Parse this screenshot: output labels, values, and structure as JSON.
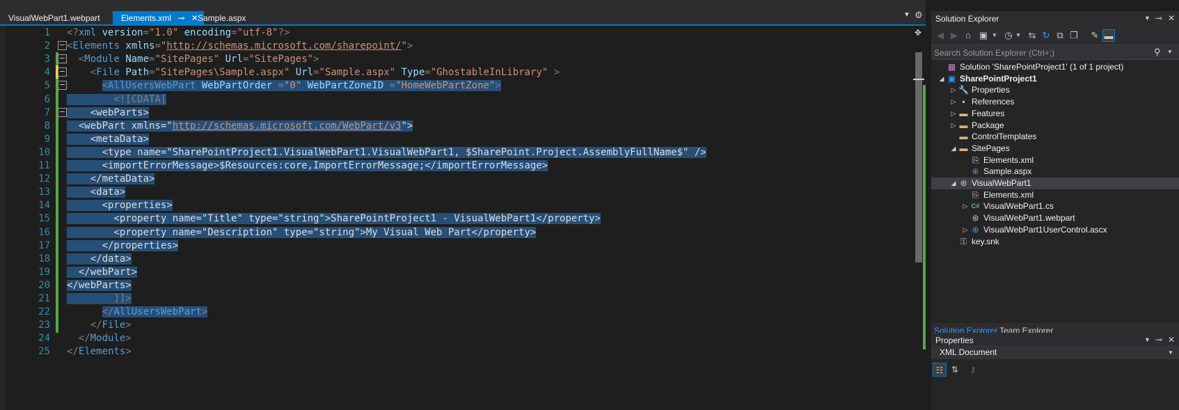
{
  "tabs": {
    "items": [
      {
        "label": "VisualWebPart1.webpart",
        "active": false
      },
      {
        "label": "Elements.xml",
        "active": true
      },
      {
        "label": "Sample.aspx",
        "active": false
      }
    ],
    "pin_icon": "pin-icon",
    "close_icon": "close-icon",
    "menu_icon": "chevron-down-icon",
    "gear_icon": "gear-icon"
  },
  "editor": {
    "line_numbers": [
      "1",
      "2",
      "3",
      "4",
      "5",
      "6",
      "7",
      "8",
      "9",
      "10",
      "11",
      "12",
      "13",
      "14",
      "15",
      "16",
      "17",
      "18",
      "19",
      "20",
      "21",
      "22",
      "23",
      "24",
      "25"
    ],
    "colors": {
      "tag": "#569cd6",
      "attr": "#9cdcfe",
      "string": "#ce9178",
      "text": "#dcdcdc",
      "punct": "#808080",
      "selection": "#264f78",
      "line_number": "#2b91af"
    },
    "lines": [
      [
        [
          "pun",
          "<?"
        ],
        [
          "tag",
          "xml "
        ],
        [
          "attr",
          "version"
        ],
        [
          "pun",
          "="
        ],
        [
          "str",
          "\"1.0\""
        ],
        [
          "pun",
          " "
        ],
        [
          "attr",
          "encoding"
        ],
        [
          "pun",
          "="
        ],
        [
          "str",
          "\"utf-8\""
        ],
        [
          "pun",
          "?>"
        ]
      ],
      [
        [
          "pun",
          "<"
        ],
        [
          "tag",
          "Elements "
        ],
        [
          "attr",
          "xmlns"
        ],
        [
          "pun",
          "="
        ],
        [
          "str",
          "\""
        ],
        [
          "url",
          "http://schemas.microsoft.com/sharepoint/"
        ],
        [
          "str",
          "\""
        ],
        [
          "pun",
          ">"
        ]
      ],
      [
        [
          "pun",
          "  <"
        ],
        [
          "tag",
          "Module "
        ],
        [
          "attr",
          "Name"
        ],
        [
          "pun",
          "="
        ],
        [
          "str",
          "\"SitePages\""
        ],
        [
          "pun",
          " "
        ],
        [
          "attr",
          "Url"
        ],
        [
          "pun",
          "="
        ],
        [
          "str",
          "\"SitePages\""
        ],
        [
          "pun",
          ">"
        ]
      ],
      [
        [
          "pun",
          "    <"
        ],
        [
          "tag",
          "File "
        ],
        [
          "attr",
          "Path"
        ],
        [
          "pun",
          "="
        ],
        [
          "str",
          "\"SitePages\\Sample.aspx\""
        ],
        [
          "pun",
          " "
        ],
        [
          "attr",
          "Url"
        ],
        [
          "pun",
          "="
        ],
        [
          "str",
          "\"Sample.aspx\""
        ],
        [
          "pun",
          " "
        ],
        [
          "attr",
          "Type"
        ],
        [
          "pun",
          "="
        ],
        [
          "str",
          "\"GhostableInLibrary\""
        ],
        [
          "pun",
          " >"
        ]
      ],
      [
        [
          "pun",
          "      "
        ],
        [
          "selpun",
          "<"
        ],
        [
          "seltag",
          "AllUsersWebPart "
        ],
        [
          "selattr",
          "WebPartOrder "
        ],
        [
          "selpun",
          "="
        ],
        [
          "selstr",
          "\"0\""
        ],
        [
          "selpun",
          " "
        ],
        [
          "selattr",
          "WebPartZoneID "
        ],
        [
          "selpun",
          "="
        ],
        [
          "selstr",
          "\"HomeWebPartZone\""
        ],
        [
          "selpun",
          ">"
        ]
      ],
      [
        [
          "selpun",
          "        <![CDATA["
        ]
      ],
      [
        [
          "seltxt",
          "    <webParts>"
        ]
      ],
      [
        [
          "seltxt",
          "  <webPart xmlns=\""
        ],
        [
          "selurl",
          "http://schemas.microsoft.com/WebPart/v3"
        ],
        [
          "seltxt",
          "\">"
        ]
      ],
      [
        [
          "seltxt",
          "    <metaData>"
        ]
      ],
      [
        [
          "seltxt",
          "      <type name=\"SharePointProject1.VisualWebPart1.VisualWebPart1, $SharePoint.Project.AssemblyFullName$\" />"
        ]
      ],
      [
        [
          "seltxt",
          "      <importErrorMessage>$Resources:core,ImportErrorMessage;</importErrorMessage>"
        ]
      ],
      [
        [
          "seltxt",
          "    </metaData>"
        ]
      ],
      [
        [
          "seltxt",
          "    <data>"
        ]
      ],
      [
        [
          "seltxt",
          "      <properties>"
        ]
      ],
      [
        [
          "seltxt",
          "        <property name=\"Title\" type=\"string\">SharePointProject1 - VisualWebPart1</property>"
        ]
      ],
      [
        [
          "seltxt",
          "        <property name=\"Description\" type=\"string\">My Visual Web Part</property>"
        ]
      ],
      [
        [
          "seltxt",
          "      </properties>"
        ]
      ],
      [
        [
          "seltxt",
          "    </data>"
        ]
      ],
      [
        [
          "seltxt",
          "  </webPart>"
        ]
      ],
      [
        [
          "seltxt",
          "</webParts>"
        ]
      ],
      [
        [
          "selpun",
          "        ]]>"
        ]
      ],
      [
        [
          "pun",
          "      "
        ],
        [
          "selpun",
          "</"
        ],
        [
          "seltag",
          "AllUsersWebPart"
        ],
        [
          "selpun",
          ">"
        ]
      ],
      [
        [
          "pun",
          "    </"
        ],
        [
          "tag",
          "File"
        ],
        [
          "pun",
          ">"
        ]
      ],
      [
        [
          "pun",
          "  </"
        ],
        [
          "tag",
          "Module"
        ],
        [
          "pun",
          ">"
        ]
      ],
      [
        [
          "pun",
          "</"
        ],
        [
          "tag",
          "Elements"
        ],
        [
          "pun",
          ">"
        ]
      ]
    ]
  },
  "solution_explorer": {
    "title": "Solution Explorer",
    "title_buttons": [
      "dropdown-icon",
      "pin-icon",
      "close-icon"
    ],
    "toolbar_icons": [
      "back-icon",
      "forward-icon",
      "home-icon",
      "switch-views-icon",
      "pending-changes-icon",
      "sync-icon",
      "refresh-icon",
      "collapse-all-icon",
      "show-all-files-icon",
      "properties-icon",
      "preview-icon"
    ],
    "search_placeholder": "Search Solution Explorer (Ctrl+;)",
    "tree": [
      {
        "label": "Solution 'SharePointProject1' (1 of 1 project)",
        "depth": 0,
        "expander": "",
        "icon": "solution-icon",
        "bold": false,
        "selected": false
      },
      {
        "label": "SharePointProject1",
        "depth": 0,
        "expander": "expanded",
        "icon": "project-icon",
        "bold": true,
        "selected": false
      },
      {
        "label": "Properties",
        "depth": 1,
        "expander": "collapsed",
        "icon": "wrench-icon",
        "bold": false,
        "selected": false
      },
      {
        "label": "References",
        "depth": 1,
        "expander": "collapsed",
        "icon": "references-icon",
        "bold": false,
        "selected": false
      },
      {
        "label": "Features",
        "depth": 1,
        "expander": "collapsed",
        "icon": "folder-icon",
        "bold": false,
        "selected": false
      },
      {
        "label": "Package",
        "depth": 1,
        "expander": "collapsed",
        "icon": "folder-icon",
        "bold": false,
        "selected": false
      },
      {
        "label": "ControlTemplates",
        "depth": 1,
        "expander": "",
        "icon": "folder-icon",
        "bold": false,
        "selected": false
      },
      {
        "label": "SitePages",
        "depth": 1,
        "expander": "expanded",
        "icon": "folder-icon",
        "bold": false,
        "selected": false
      },
      {
        "label": "Elements.xml",
        "depth": 2,
        "expander": "",
        "icon": "xml-file-icon",
        "bold": false,
        "selected": false
      },
      {
        "label": "Sample.aspx",
        "depth": 2,
        "expander": "",
        "icon": "web-file-icon",
        "bold": false,
        "selected": false
      },
      {
        "label": "VisualWebPart1",
        "depth": 1,
        "expander": "expanded",
        "icon": "web-part-icon",
        "bold": false,
        "selected": true
      },
      {
        "label": "Elements.xml",
        "depth": 2,
        "expander": "",
        "icon": "xml-file-icon",
        "bold": false,
        "selected": false
      },
      {
        "label": "VisualWebPart1.cs",
        "depth": 2,
        "expander": "collapsed",
        "icon": "csharp-file-icon",
        "bold": false,
        "selected": false
      },
      {
        "label": "VisualWebPart1.webpart",
        "depth": 2,
        "expander": "",
        "icon": "web-part-icon",
        "bold": false,
        "selected": false
      },
      {
        "label": "VisualWebPart1UserControl.ascx",
        "depth": 2,
        "expander": "collapsed",
        "icon": "user-control-icon",
        "bold": false,
        "selected": false
      },
      {
        "label": "key.snk",
        "depth": 1,
        "expander": "",
        "icon": "key-file-icon",
        "bold": false,
        "selected": false
      }
    ],
    "bottom_tabs": [
      {
        "label": "Solution Explorer",
        "active": true
      },
      {
        "label": "Team Explorer",
        "active": false
      }
    ]
  },
  "properties_panel": {
    "title": "Properties",
    "selected_object": "XML Document",
    "toolbar_icons": [
      "categorized-icon",
      "alphabetical-icon",
      "property-pages-icon"
    ]
  }
}
